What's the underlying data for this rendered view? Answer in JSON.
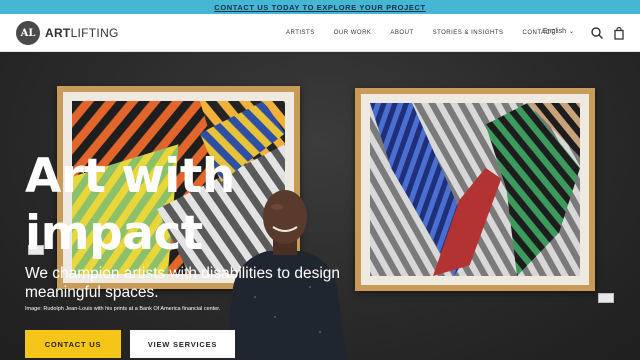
{
  "announcement": {
    "text": "CONTACT US TODAY TO EXPLORE YOUR PROJECT"
  },
  "header": {
    "logo_mark": "AL",
    "logo_text_bold": "ART",
    "logo_text": "LIFTING",
    "nav": [
      {
        "label": "ARTISTS"
      },
      {
        "label": "OUR WORK"
      },
      {
        "label": "ABOUT"
      },
      {
        "label": "STORIES & INSIGHTS"
      },
      {
        "label": "CONTACT"
      }
    ],
    "language": "English",
    "icons": [
      "search-icon",
      "shopping-bag-icon"
    ]
  },
  "hero": {
    "headline_line1": "Art with",
    "headline_line2": "impact",
    "subline": "We champion artists with disabilities to design meaningful spaces.",
    "caption": "Image: Rudolph Jean-Louis with his prints at a Bank Of America financial center.",
    "cta_primary": "CONTACT US",
    "cta_secondary": "VIEW SERVICES"
  },
  "colors": {
    "announce_bg": "#45b6d4",
    "cta_primary_bg": "#f5c518",
    "frame_wood": "#c99b58"
  }
}
